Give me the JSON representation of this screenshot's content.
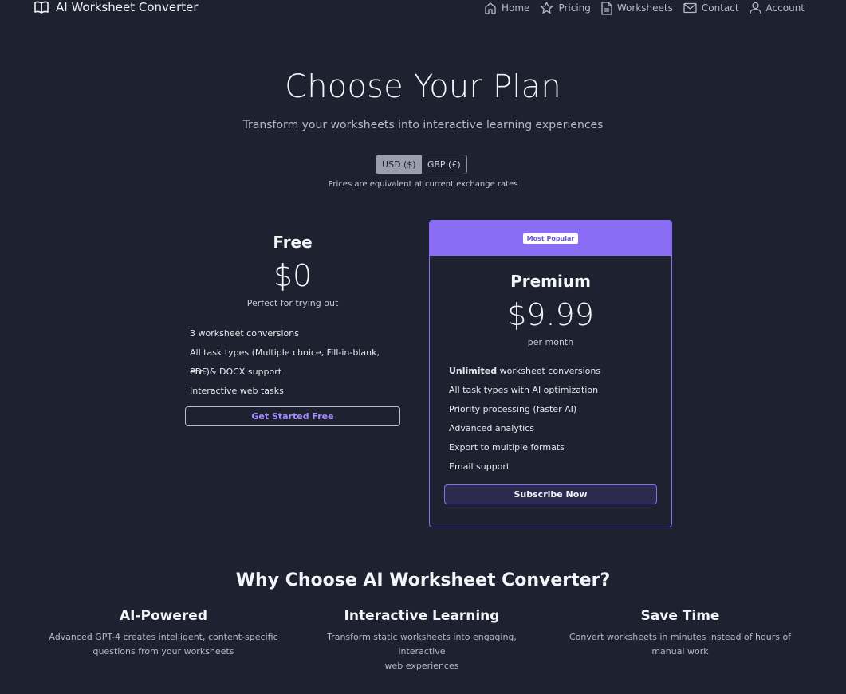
{
  "nav": {
    "brand": "AI Worksheet Converter",
    "links": [
      {
        "label": "Home",
        "icon": "home-icon"
      },
      {
        "label": "Pricing",
        "icon": "star-icon"
      },
      {
        "label": "Worksheets",
        "icon": "document-icon"
      },
      {
        "label": "Contact",
        "icon": "mail-icon"
      },
      {
        "label": "Account",
        "icon": "user-icon"
      }
    ]
  },
  "hero": {
    "title": "Choose Your Plan",
    "subtitle": "Transform your worksheets into interactive learning experiences"
  },
  "currency": {
    "usd": "USD ($)",
    "gbp": "GBP (£)",
    "selected": "USD ($)",
    "note": "Prices are equivalent at current exchange rates"
  },
  "plans": {
    "free": {
      "name": "Free",
      "price": "$0",
      "description": "Perfect for trying out",
      "features": [
        "3 worksheet conversions",
        "All task types (Multiple choice, Fill-in-blank, etc.)",
        "PDF & DOCX support",
        "Interactive web tasks"
      ],
      "cta": "Get Started Free"
    },
    "premium": {
      "badge": "Most Popular",
      "name": "Premium",
      "price": "$9.99",
      "period": "per month",
      "features": [
        {
          "bold": "Unlimited",
          "text": " worksheet conversions"
        },
        {
          "bold": "",
          "text": "All task types with AI optimization"
        },
        {
          "bold": "",
          "text": "Priority processing (faster AI)"
        },
        {
          "bold": "",
          "text": "Advanced analytics"
        },
        {
          "bold": "",
          "text": "Export to multiple formats"
        },
        {
          "bold": "",
          "text": "Email support"
        }
      ],
      "cta": "Subscribe Now"
    }
  },
  "why": {
    "title": "Why Choose AI Worksheet Converter?",
    "features": [
      {
        "title": "AI-Powered",
        "line1": "Advanced GPT-4 creates intelligent, content-specific",
        "line2": "questions from your worksheets"
      },
      {
        "title": "Interactive Learning",
        "line1": "Transform static worksheets into engaging, interactive",
        "line2": "web experiences"
      },
      {
        "title": "Save Time",
        "line1": "Convert worksheets in minutes instead of hours of",
        "line2": "manual work"
      }
    ]
  },
  "colors": {
    "background": "#1e2130",
    "accent": "#8b6cf5",
    "accent_text": "#a48cff"
  }
}
